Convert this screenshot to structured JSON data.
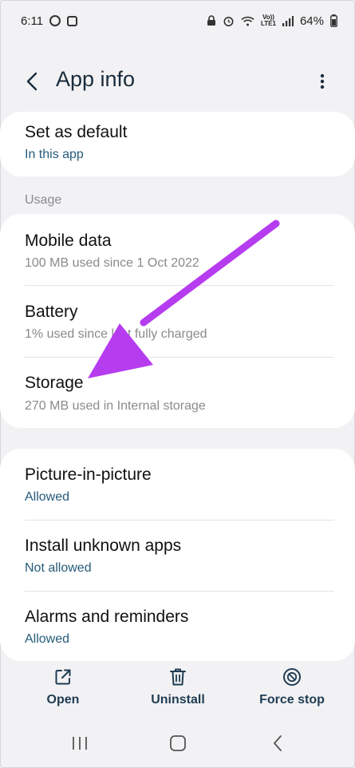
{
  "status_bar": {
    "time": "6:11",
    "battery": "64%",
    "network": "LTE1",
    "volte": "Vo))"
  },
  "header": {
    "title": "App info"
  },
  "defaults_card": {
    "title": "Set as default",
    "subtitle": "In this app"
  },
  "usage": {
    "section_label": "Usage",
    "items": [
      {
        "title": "Mobile data",
        "subtitle": "100 MB used since 1 Oct 2022"
      },
      {
        "title": "Battery",
        "subtitle": "1% used since last fully charged"
      },
      {
        "title": "Storage",
        "subtitle": "270 MB used in Internal storage"
      }
    ]
  },
  "permissions": {
    "items": [
      {
        "title": "Picture-in-picture",
        "subtitle": "Allowed"
      },
      {
        "title": "Install unknown apps",
        "subtitle": "Not allowed"
      },
      {
        "title": "Alarms and reminders",
        "subtitle": "Allowed"
      }
    ]
  },
  "actions": {
    "open": "Open",
    "uninstall": "Uninstall",
    "force_stop": "Force stop"
  },
  "colors": {
    "accent_blue": "#255b7a",
    "annotation_arrow": "#b63cf0"
  },
  "icons": {
    "back": "chevron-left-icon",
    "more": "more-vertical-icon",
    "open": "external-link-icon",
    "uninstall": "trash-icon",
    "force_stop": "stop-circle-icon"
  }
}
